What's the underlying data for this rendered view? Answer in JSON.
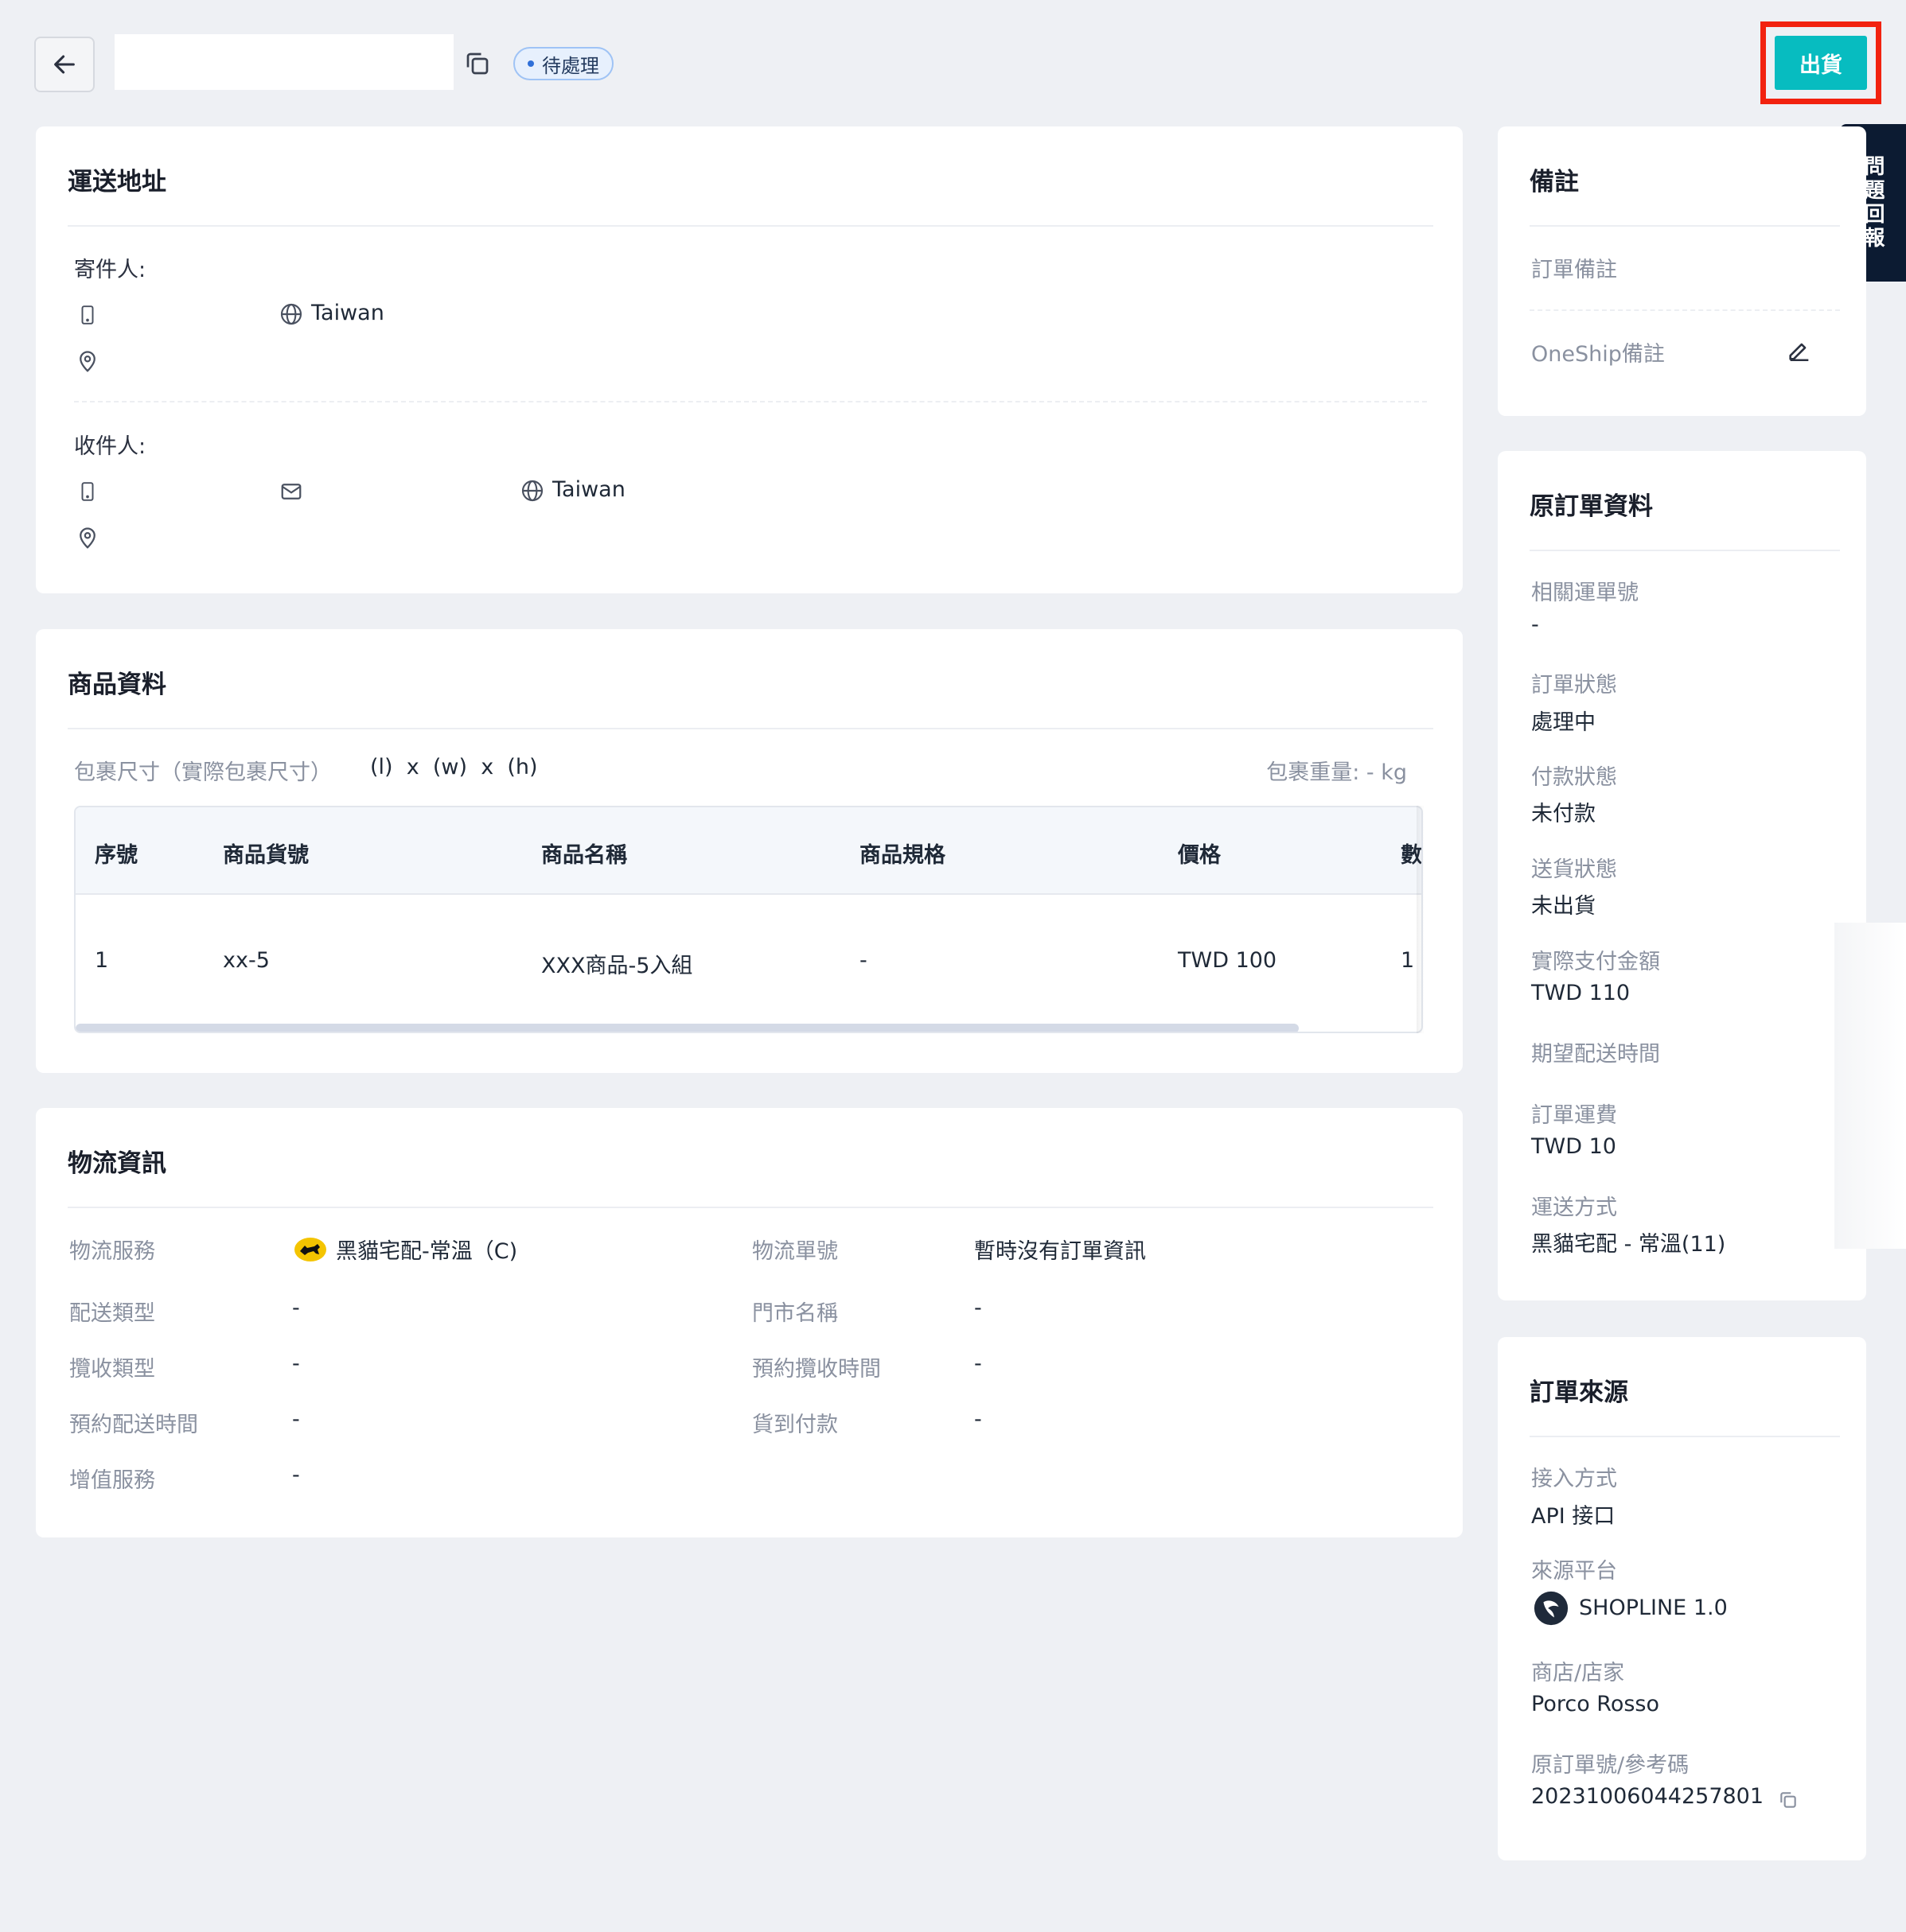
{
  "header": {
    "status": "待處理",
    "ship_label": "出貨",
    "feedback_label": "問題回報"
  },
  "shipping_address": {
    "title": "運送地址",
    "sender_label": "寄件人:",
    "sender_country": "Taiwan",
    "receiver_label": "收件人:",
    "receiver_country": "Taiwan"
  },
  "product": {
    "title": "商品資料",
    "size_label": "包裹尺寸（實際包裹尺寸）",
    "size_value": "(l)  x  (w)  x  (h)",
    "weight_label": "包裹重量: - kg",
    "columns": [
      "序號",
      "商品貨號",
      "商品名稱",
      "商品規格",
      "價格",
      "數"
    ],
    "rows": [
      [
        "1",
        "xx-5",
        "XXX商品-5入組",
        "-",
        "TWD 100",
        "1"
      ]
    ]
  },
  "logistics": {
    "title": "物流資訊",
    "service_label": "物流服務",
    "service_value": "黑貓宅配-常溫（C)",
    "tracking_label": "物流單號",
    "tracking_value": "暫時沒有訂單資訊",
    "delivery_type_label": "配送類型",
    "delivery_type_value": "-",
    "store_name_label": "門市名稱",
    "store_name_value": "-",
    "pickup_type_label": "攬收類型",
    "pickup_type_value": "-",
    "pickup_time_label": "預約攬收時間",
    "pickup_time_value": "-",
    "delivery_time_label": "預約配送時間",
    "delivery_time_value": "-",
    "cod_label": "貨到付款",
    "cod_value": "-",
    "value_added_label": "增值服務",
    "value_added_value": "-"
  },
  "notes": {
    "title": "備註",
    "order_note_label": "訂單備註",
    "oneship_note_label": "OneShip備註"
  },
  "original_order": {
    "title": "原訂單資料",
    "items": [
      {
        "label": "相關運單號",
        "value": "-"
      },
      {
        "label": "訂單狀態",
        "value": "處理中"
      },
      {
        "label": "付款狀態",
        "value": "未付款"
      },
      {
        "label": "送貨狀態",
        "value": "未出貨"
      },
      {
        "label": "實際支付金額",
        "value": "TWD 110"
      },
      {
        "label": "期望配送時間",
        "value": ""
      },
      {
        "label": "訂單運費",
        "value": "TWD 10"
      },
      {
        "label": "運送方式",
        "value": "黑貓宅配 - 常溫(11)"
      }
    ]
  },
  "order_source": {
    "title": "訂單來源",
    "access_label": "接入方式",
    "access_value": "API 接口",
    "platform_label": "來源平台",
    "platform_value": "SHOPLINE 1.0",
    "store_label": "商店/店家",
    "store_value": "Porco Rosso",
    "ref_label": "原訂單號/參考碼",
    "ref_value": "20231006044257801"
  }
}
